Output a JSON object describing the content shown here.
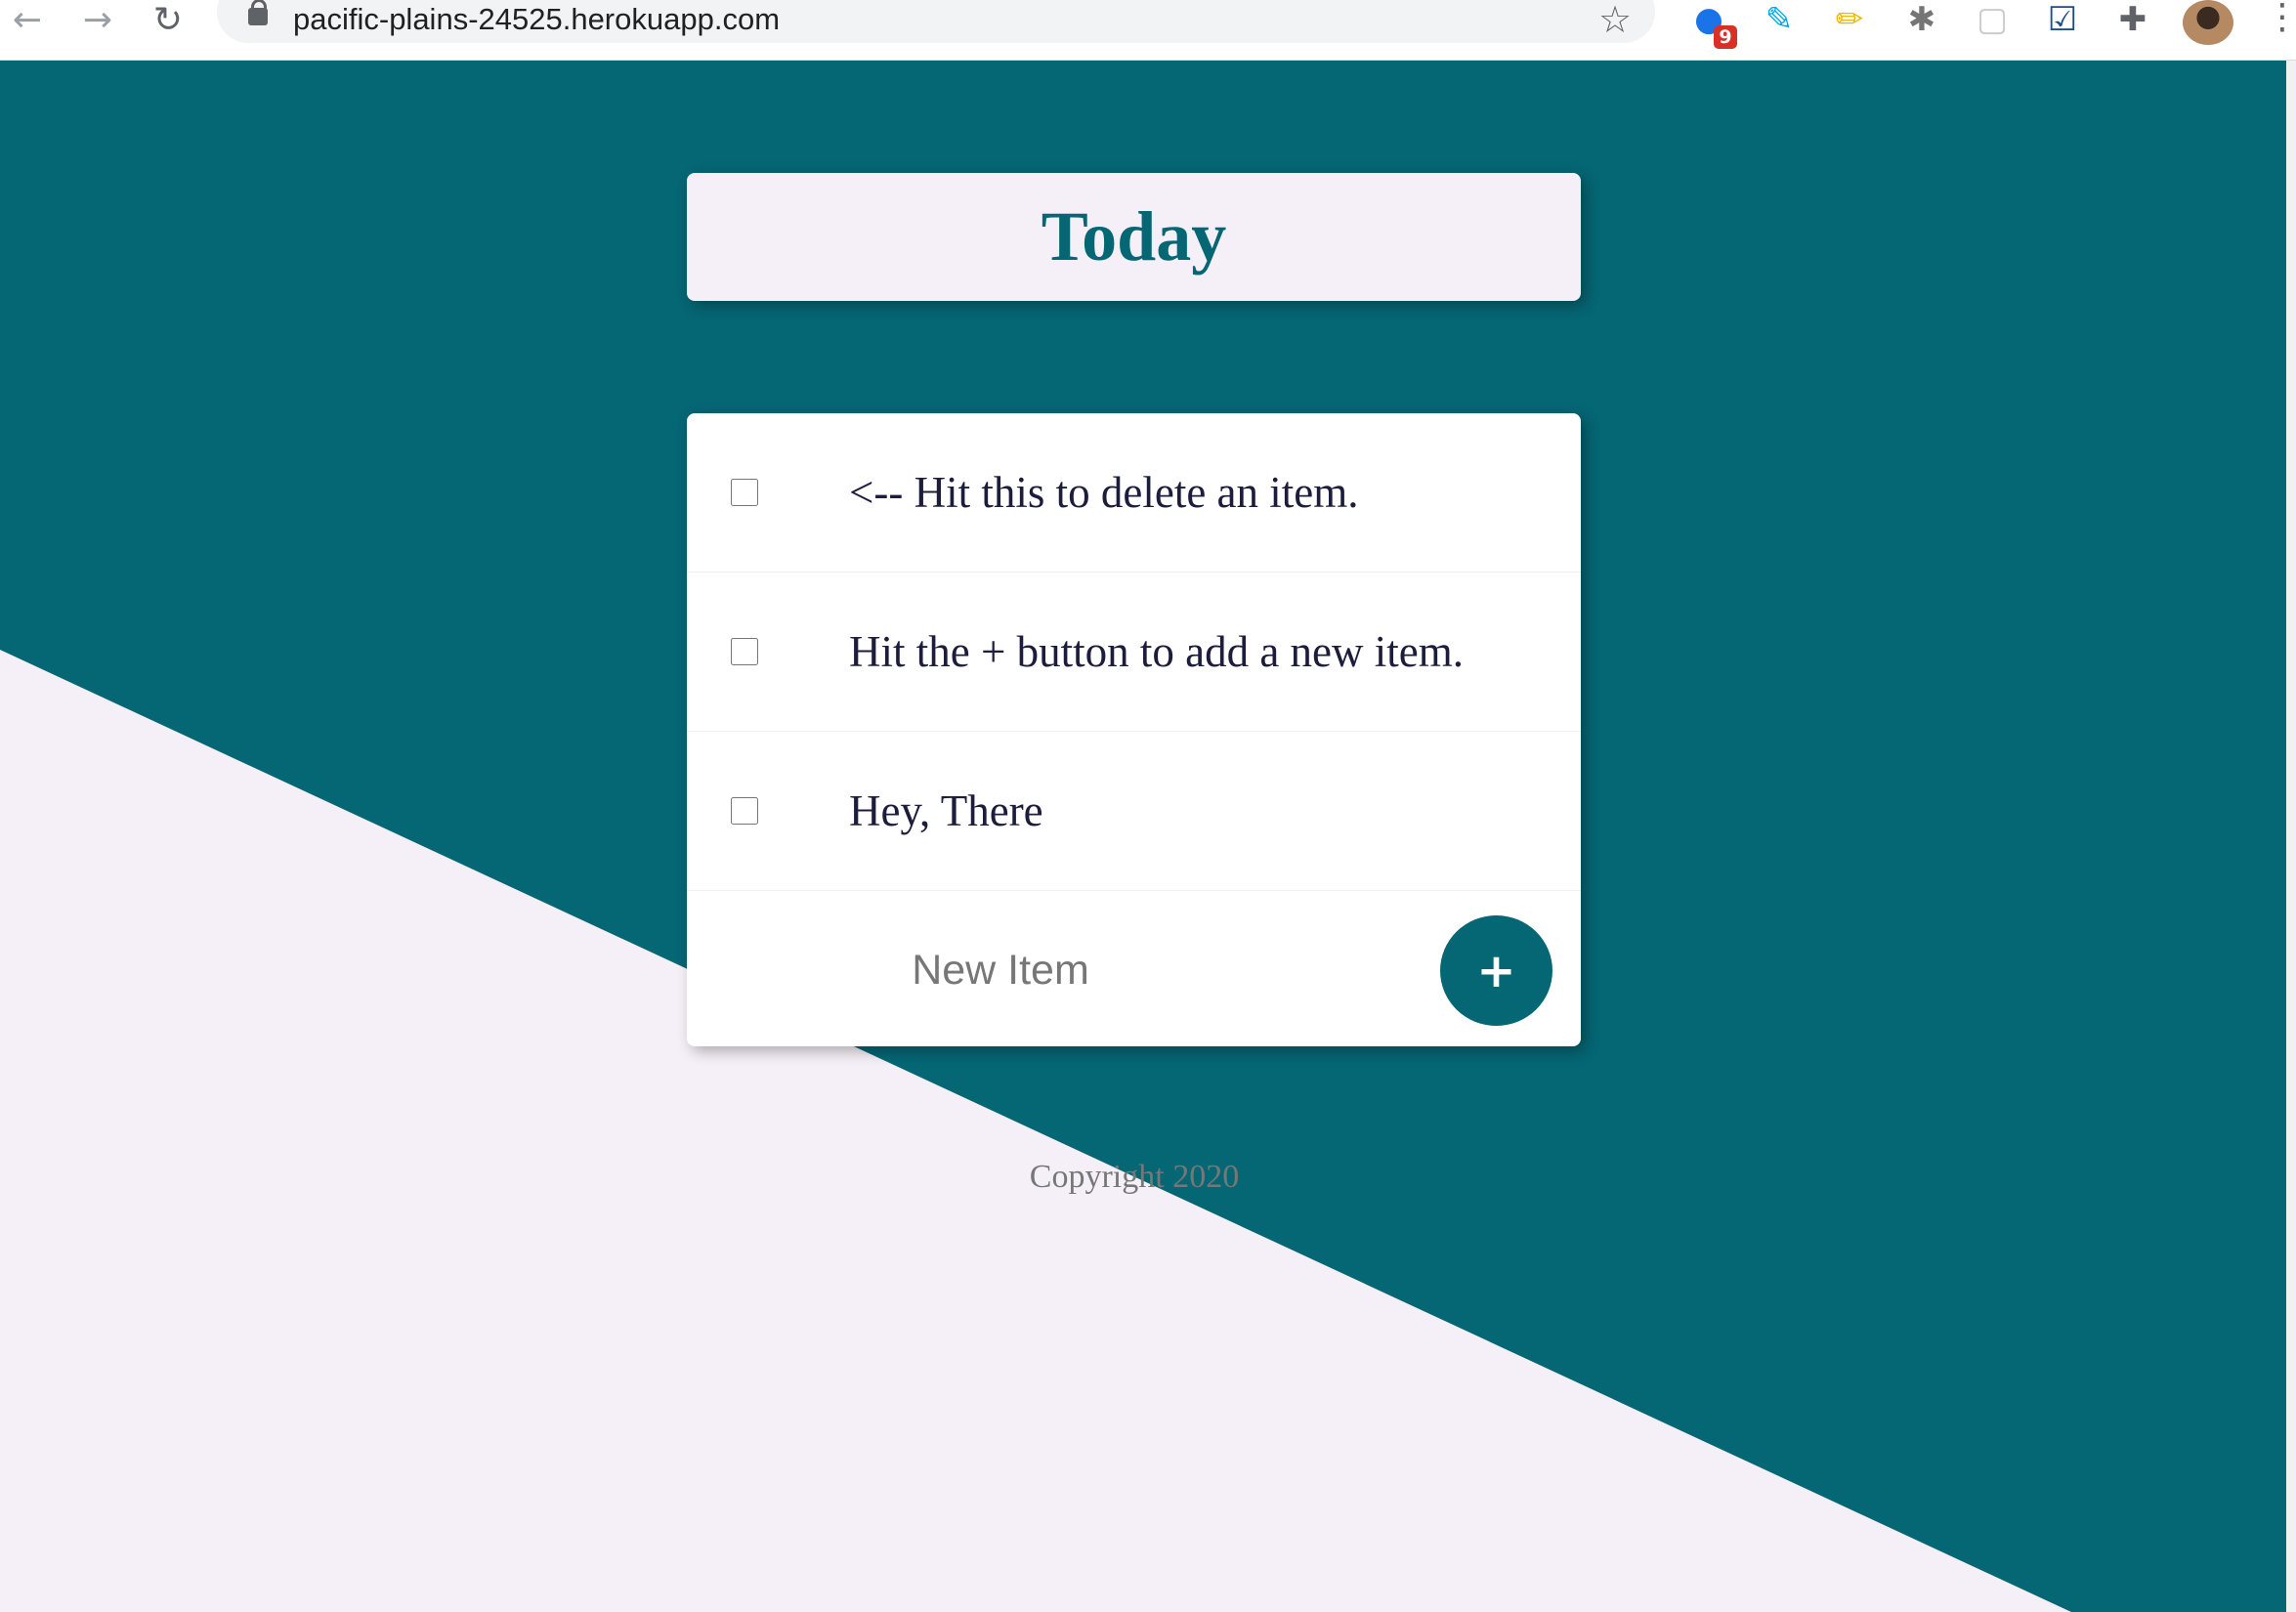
{
  "browser": {
    "url": "pacific-plains-24525.herokuapp.com",
    "back_icon": "←",
    "forward_icon": "→",
    "reload_icon": "↻",
    "star_icon": "☆",
    "menu_icon": "⋮",
    "extensions": [
      {
        "name": "extension-blue-icon",
        "glyph": "●",
        "color": "#1a73e8",
        "badge": "9"
      },
      {
        "name": "extension-teal-icon",
        "glyph": "✎",
        "color": "#00a7e1"
      },
      {
        "name": "highlighter-icon",
        "glyph": "✏",
        "color": "#f4b400"
      },
      {
        "name": "bug-icon",
        "glyph": "✱",
        "color": "#757575"
      },
      {
        "name": "extension-grey-icon",
        "glyph": "▢",
        "color": "#cccccc"
      },
      {
        "name": "checkbox-extension-icon",
        "glyph": "☑",
        "color": "#1a4f8a"
      },
      {
        "name": "puzzle-icon",
        "glyph": "✚",
        "color": "#5f6368"
      }
    ]
  },
  "colors": {
    "primary": "#056674",
    "secondary": "#f5f0f7",
    "item_text": "#1c1c3c"
  },
  "heading": {
    "title": "Today"
  },
  "items": [
    {
      "text": "<-- Hit this to delete an item.",
      "checked": false
    },
    {
      "text": "Hit the + button to add a new item.",
      "checked": false
    },
    {
      "text": "Hey, There",
      "checked": false
    }
  ],
  "new_item": {
    "placeholder": "New Item",
    "value": "",
    "button_label": "+"
  },
  "footer": {
    "text": "Copyright 2020"
  }
}
